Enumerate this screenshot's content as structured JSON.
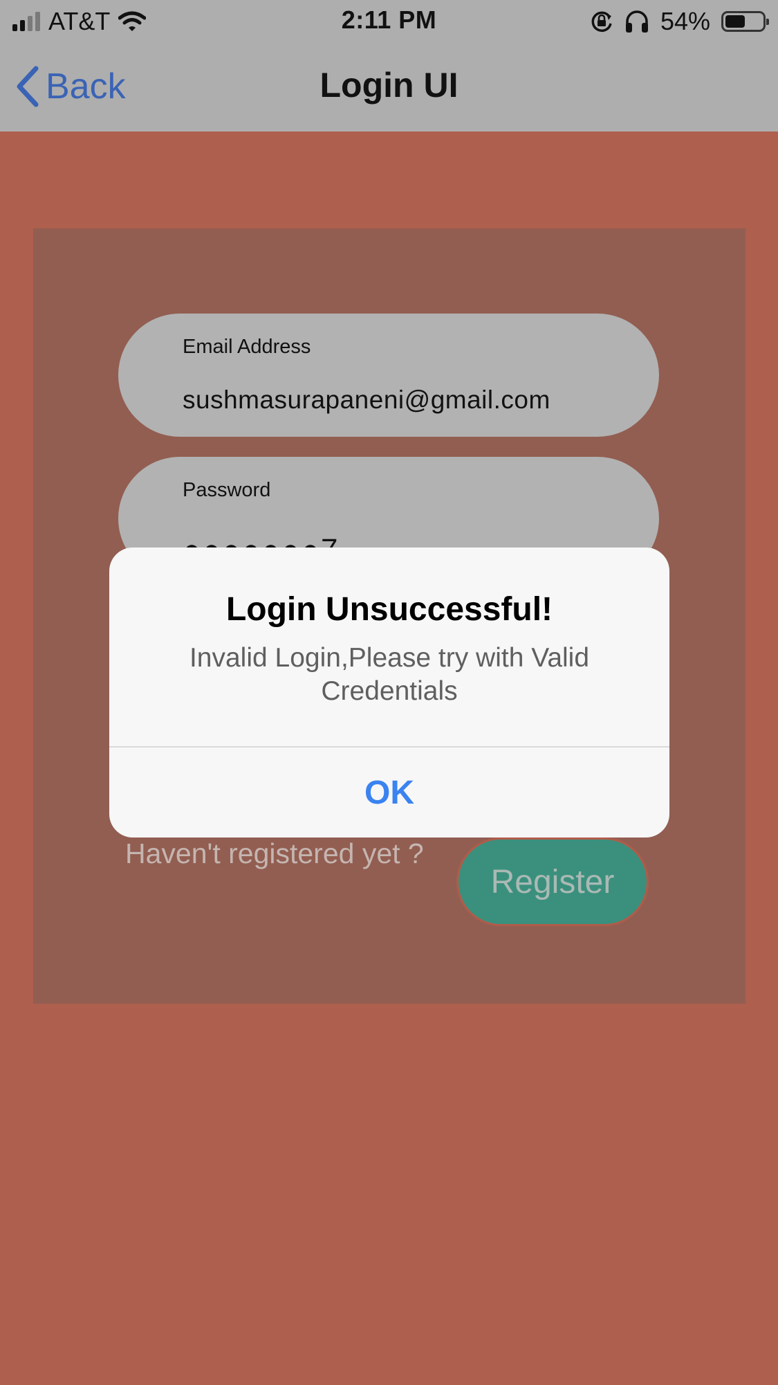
{
  "status_bar": {
    "carrier": "AT&T",
    "time": "2:11 PM",
    "battery_percent": "54%",
    "battery_level": 0.54,
    "icons": [
      "signal-icon",
      "wifi-icon",
      "orientation-lock-icon",
      "headphones-icon",
      "battery-icon"
    ]
  },
  "nav": {
    "back_label": "Back",
    "title": "Login UI"
  },
  "form": {
    "email_label": "Email Address",
    "email_value": "sushmasurapaneni@gmail.com",
    "password_label": "Password",
    "password_value": "●●●●●●●7"
  },
  "register": {
    "prompt": "Haven't registered yet ?",
    "button_label": "Register"
  },
  "alert": {
    "title": "Login Unsuccessful!",
    "message": "Invalid Login,Please try with Valid Credentials",
    "ok_label": "OK"
  },
  "colors": {
    "background": "#ae5f4d",
    "card": "#925e51",
    "field": "#b2b2b2",
    "register_button": "#3a907d",
    "alert_action": "#3a83f0",
    "back_link": "#3a63b5"
  }
}
